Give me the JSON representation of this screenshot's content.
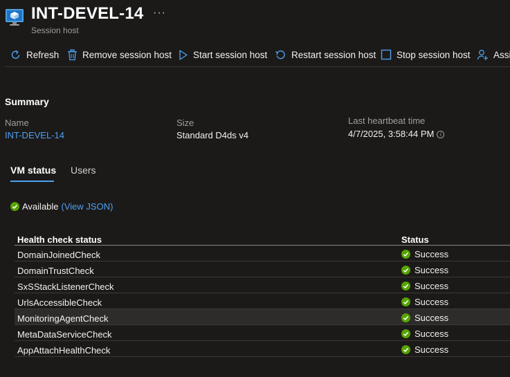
{
  "header": {
    "title": "INT-DEVEL-14",
    "subtitle": "Session host",
    "more_label": "···"
  },
  "toolbar": {
    "refresh": "Refresh",
    "remove": "Remove session host",
    "start": "Start session host",
    "restart": "Restart session host",
    "stop": "Stop session host",
    "assign": "Assi"
  },
  "summary": {
    "title": "Summary",
    "name_label": "Name",
    "name_value": "INT-DEVEL-14",
    "size_label": "Size",
    "size_value": "Standard D4ds v4",
    "heartbeat_label": "Last heartbeat time",
    "heartbeat_value": "4/7/2025, 3:58:44 PM"
  },
  "tabs": [
    {
      "label": "VM status",
      "active": true
    },
    {
      "label": "Users",
      "active": false
    }
  ],
  "availability": {
    "status": "Available",
    "link": "(View JSON)"
  },
  "table": {
    "headers": {
      "check": "Health check status",
      "status": "Status"
    },
    "rows": [
      {
        "check": "DomainJoinedCheck",
        "status": "Success"
      },
      {
        "check": "DomainTrustCheck",
        "status": "Success"
      },
      {
        "check": "SxSStackListenerCheck",
        "status": "Success"
      },
      {
        "check": "UrlsAccessibleCheck",
        "status": "Success"
      },
      {
        "check": "MonitoringAgentCheck",
        "status": "Success"
      },
      {
        "check": "MetaDataServiceCheck",
        "status": "Success"
      },
      {
        "check": "AppAttachHealthCheck",
        "status": "Success"
      }
    ],
    "highlighted_row": 4
  },
  "colors": {
    "background": "#1b1a19",
    "accent": "#4ea0f0",
    "success": "#57a300",
    "text": "#f3f2f1",
    "muted": "#a19f9d"
  }
}
